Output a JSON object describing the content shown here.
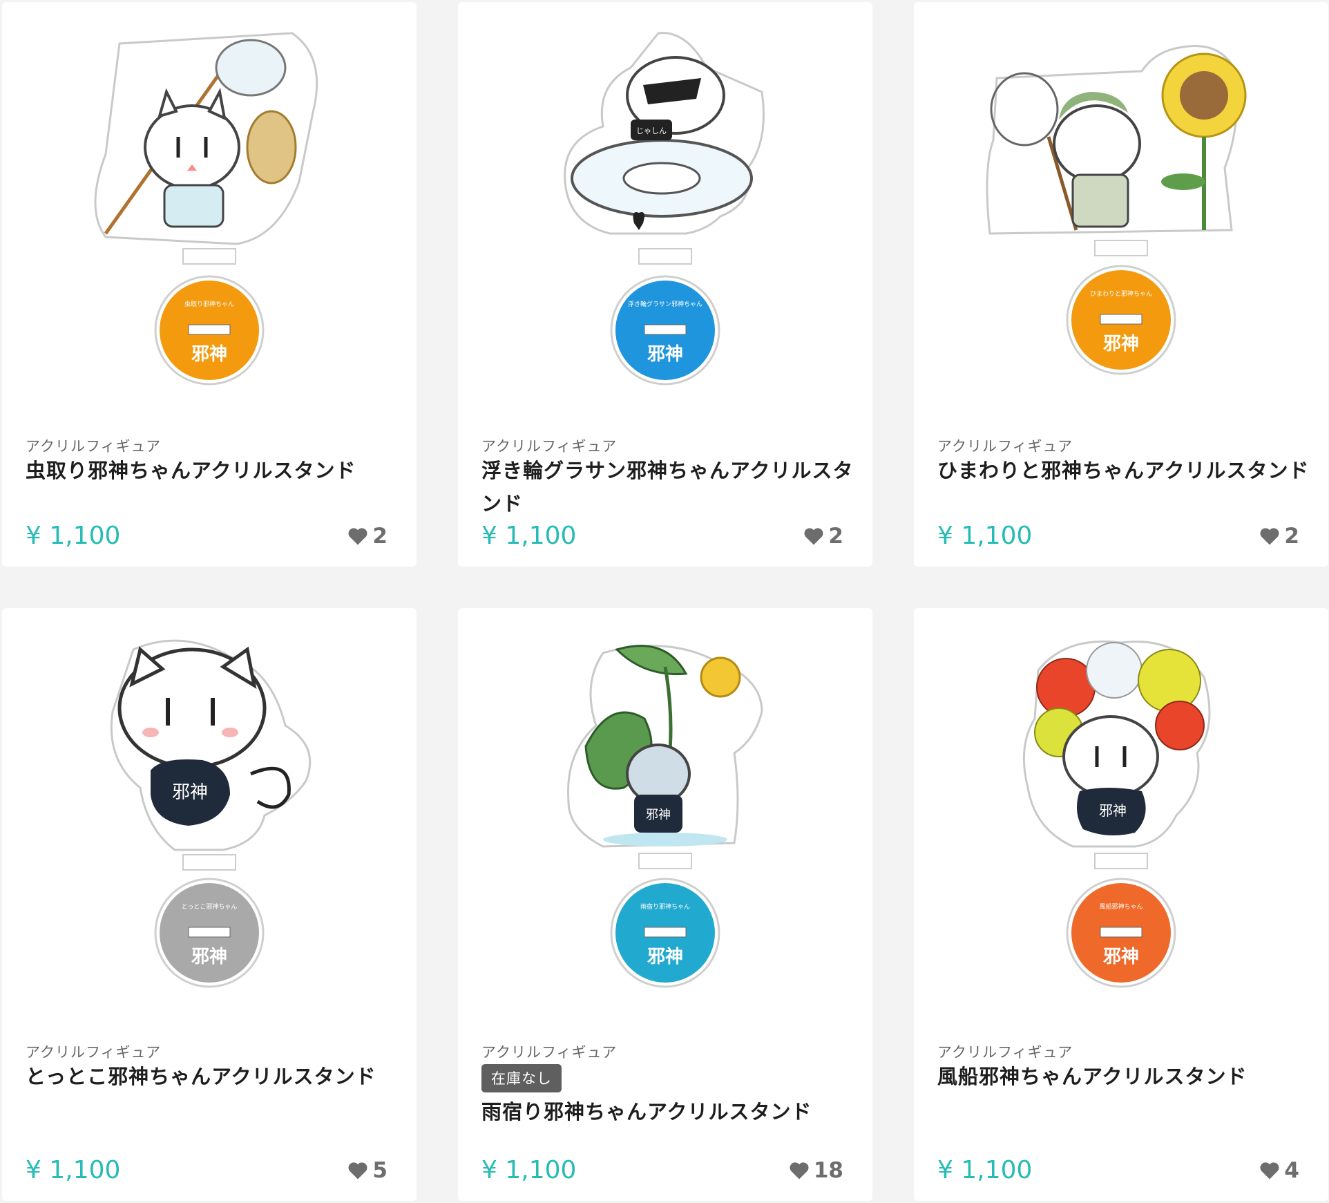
{
  "products": [
    {
      "category": "アクリルフィギュア",
      "title": "虫取り邪神ちゃんアクリルスタンド",
      "price": "¥ 1,100",
      "likes": "2",
      "base_color": "#f39a0f",
      "base_text": "虫取り邪神ちゃん",
      "badge": ""
    },
    {
      "category": "アクリルフィギュア",
      "title": "浮き輪グラサン邪神ちゃんアクリルスタンド",
      "price": "¥ 1,100",
      "likes": "2",
      "base_color": "#1f95dd",
      "base_text": "浮き輪グラサン邪神ちゃん",
      "badge": ""
    },
    {
      "category": "アクリルフィギュア",
      "title": "ひまわりと邪神ちゃんアクリルスタンド",
      "price": "¥ 1,100",
      "likes": "2",
      "base_color": "#f39a0f",
      "base_text": "ひまわりと邪神ちゃん",
      "badge": ""
    },
    {
      "category": "アクリルフィギュア",
      "title": "とっとこ邪神ちゃんアクリルスタンド",
      "price": "¥ 1,100",
      "likes": "5",
      "base_color": "#a9a9a9",
      "base_text": "とっとこ邪神ちゃん",
      "badge": ""
    },
    {
      "category": "アクリルフィギュア",
      "title": "雨宿り邪神ちゃんアクリルスタンド",
      "price": "¥ 1,100",
      "likes": "18",
      "base_color": "#22a9cf",
      "base_text": "雨宿り邪神ちゃん",
      "badge": "在庫なし"
    },
    {
      "category": "アクリルフィギュア",
      "title": "風船邪神ちゃんアクリルスタンド",
      "price": "¥ 1,100",
      "likes": "4",
      "base_color": "#ef6a2a",
      "base_text": "風船邪神ちゃん",
      "badge": ""
    }
  ],
  "icons": {
    "like": "heart-icon"
  },
  "colors": {
    "price": "#26bcb5",
    "badge_bg": "#5f5f5f",
    "page_bg": "#f3f3f3"
  }
}
